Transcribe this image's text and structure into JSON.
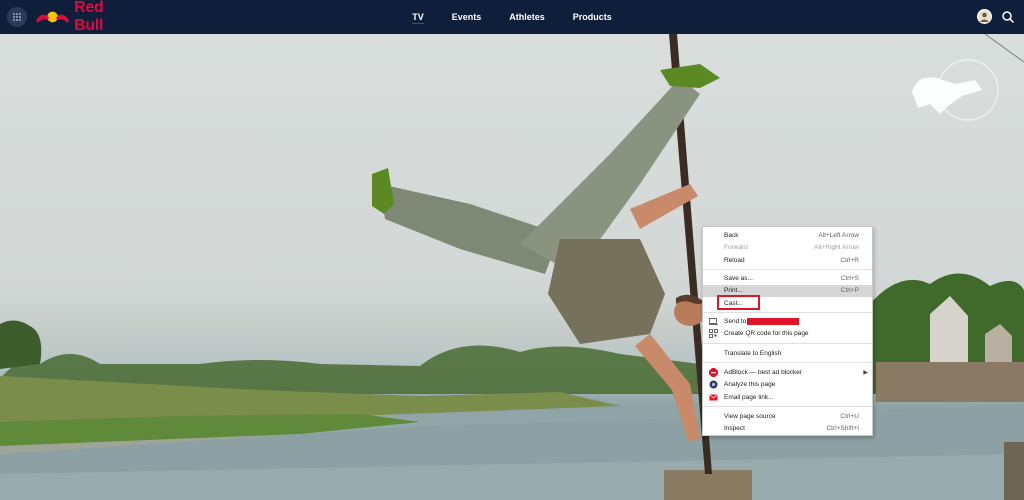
{
  "header": {
    "brand": "Red Bull",
    "nav": [
      {
        "label": "TV",
        "active": true
      },
      {
        "label": "Events",
        "active": false
      },
      {
        "label": "Athletes",
        "active": false
      },
      {
        "label": "Products",
        "active": false
      }
    ]
  },
  "colors": {
    "header_bg": "#0f1e3b",
    "brand_red": "#db0a40",
    "brand_yellow": "#f4c20d",
    "highlight_box": "#e0152b"
  },
  "icons": [
    "apps-grid-icon",
    "red-bull-logo-icon",
    "avatar-icon",
    "search-icon",
    "red-bull-watermark-icon"
  ],
  "context_menu": {
    "back": {
      "label": "Back",
      "shortcut": "Alt+Left Arrow"
    },
    "forward": {
      "label": "Forward",
      "shortcut": "Alt+Right Arrow"
    },
    "reload": {
      "label": "Reload",
      "shortcut": "Ctrl+R"
    },
    "save_as": {
      "label": "Save as...",
      "shortcut": "Ctrl+S"
    },
    "print": {
      "label": "Print...",
      "shortcut": "Ctrl+P"
    },
    "cast": {
      "label": "Cast..."
    },
    "send_to": {
      "label": "Send to"
    },
    "qr": {
      "label": "Create QR code for this page"
    },
    "translate": {
      "label": "Translate to English"
    },
    "adblock": {
      "label": "AdBlock — best ad blocker"
    },
    "analyze": {
      "label": "Analyze this page"
    },
    "email": {
      "label": "Email page link..."
    },
    "view_source": {
      "label": "View page source",
      "shortcut": "Ctrl+U"
    },
    "inspect": {
      "label": "Inspect",
      "shortcut": "Ctrl+Shift+I"
    }
  }
}
